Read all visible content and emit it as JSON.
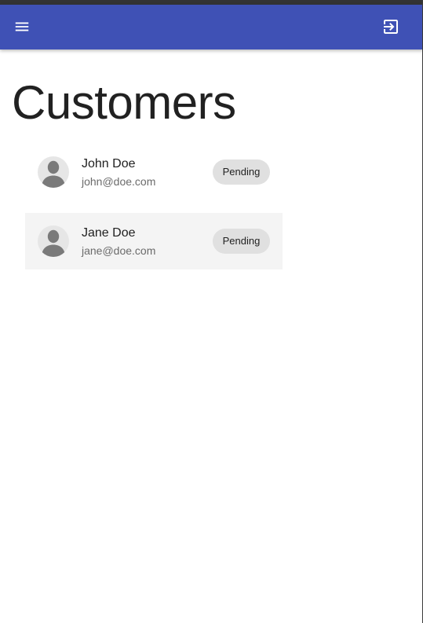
{
  "colors": {
    "app_bar": "#3f51b5",
    "status_strip": "#333333",
    "selected_row": "#f4f4f4",
    "chip_background": "#e0e0e0",
    "avatar_background": "#e6e6e6",
    "avatar_silhouette": "#7a7a7a"
  },
  "header": {
    "menu_icon": "menu-icon",
    "logout_icon": "logout-icon"
  },
  "page": {
    "title": "Customers"
  },
  "customers": [
    {
      "name": "John Doe",
      "email": "john@doe.com",
      "status": "Pending",
      "selected": false,
      "avatar_icon": "person-icon"
    },
    {
      "name": "Jane Doe",
      "email": "jane@doe.com",
      "status": "Pending",
      "selected": true,
      "avatar_icon": "person-icon"
    }
  ]
}
